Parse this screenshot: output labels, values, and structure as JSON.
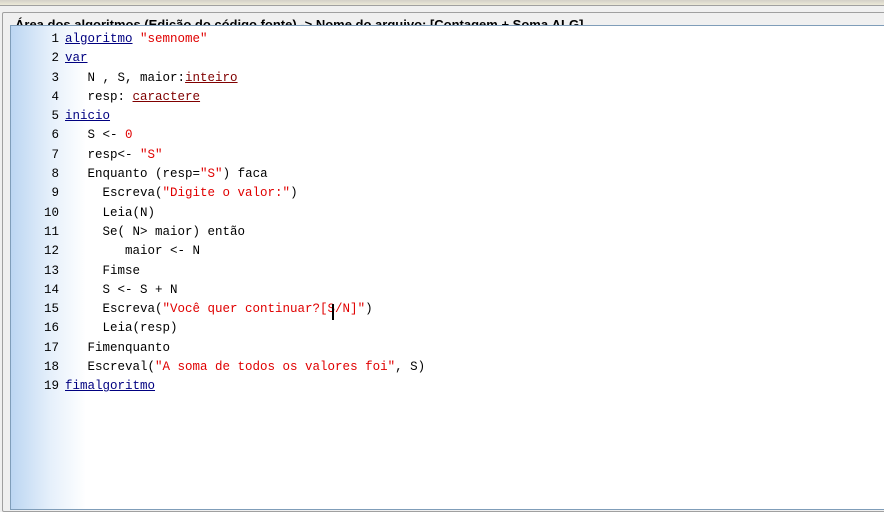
{
  "groupbox": {
    "title": "Área dos algoritmos (Edição do código fonte) -> Nome do arquivo: [Contagem + Soma.ALG]"
  },
  "code_lines": [
    {
      "n": "1",
      "indent": "",
      "tokens": [
        {
          "t": "kw",
          "v": "algoritmo"
        },
        {
          "t": "txt",
          "v": " "
        },
        {
          "t": "str",
          "v": "\"semnome\""
        }
      ]
    },
    {
      "n": "2",
      "indent": "",
      "tokens": [
        {
          "t": "kw",
          "v": "var"
        }
      ]
    },
    {
      "n": "3",
      "indent": "   ",
      "tokens": [
        {
          "t": "txt",
          "v": "N , S, maior:"
        },
        {
          "t": "type",
          "v": "inteiro"
        }
      ]
    },
    {
      "n": "4",
      "indent": "   ",
      "tokens": [
        {
          "t": "txt",
          "v": "resp: "
        },
        {
          "t": "type",
          "v": "caractere"
        }
      ]
    },
    {
      "n": "5",
      "indent": "",
      "tokens": [
        {
          "t": "kw",
          "v": "inicio"
        }
      ]
    },
    {
      "n": "6",
      "indent": "   ",
      "tokens": [
        {
          "t": "txt",
          "v": "S <- "
        },
        {
          "t": "num",
          "v": "0"
        }
      ]
    },
    {
      "n": "7",
      "indent": "   ",
      "tokens": [
        {
          "t": "txt",
          "v": "resp<- "
        },
        {
          "t": "str",
          "v": "\"S\""
        }
      ]
    },
    {
      "n": "8",
      "indent": "   ",
      "tokens": [
        {
          "t": "txt",
          "v": "Enquanto (resp="
        },
        {
          "t": "str",
          "v": "\"S\""
        },
        {
          "t": "txt",
          "v": ") faca"
        }
      ]
    },
    {
      "n": "9",
      "indent": "     ",
      "tokens": [
        {
          "t": "txt",
          "v": "Escreva("
        },
        {
          "t": "str",
          "v": "\"Digite o valor:\""
        },
        {
          "t": "txt",
          "v": ")"
        }
      ]
    },
    {
      "n": "10",
      "indent": "     ",
      "tokens": [
        {
          "t": "txt",
          "v": "Leia(N)"
        }
      ]
    },
    {
      "n": "11",
      "indent": "     ",
      "tokens": [
        {
          "t": "txt",
          "v": "Se( N> maior) então"
        }
      ]
    },
    {
      "n": "12",
      "indent": "        ",
      "tokens": [
        {
          "t": "txt",
          "v": "maior <- N"
        }
      ]
    },
    {
      "n": "13",
      "indent": "     ",
      "tokens": [
        {
          "t": "txt",
          "v": "Fimse"
        }
      ]
    },
    {
      "n": "14",
      "indent": "     ",
      "tokens": [
        {
          "t": "txt",
          "v": "S <- S + N"
        }
      ]
    },
    {
      "n": "15",
      "indent": "     ",
      "tokens": [
        {
          "t": "txt",
          "v": "Escreva("
        },
        {
          "t": "str",
          "v": "\"Você quer continuar?[S/N]\""
        },
        {
          "t": "txt",
          "v": ")"
        }
      ]
    },
    {
      "n": "16",
      "indent": "     ",
      "tokens": [
        {
          "t": "txt",
          "v": "Leia(resp)"
        }
      ]
    },
    {
      "n": "17",
      "indent": "   ",
      "tokens": [
        {
          "t": "txt",
          "v": "Fimenquanto"
        }
      ]
    },
    {
      "n": "18",
      "indent": "   ",
      "tokens": [
        {
          "t": "txt",
          "v": "Escreval("
        },
        {
          "t": "str",
          "v": "\"A soma de todos os valores foi\""
        },
        {
          "t": "txt",
          "v": ", S)"
        }
      ]
    },
    {
      "n": "19",
      "indent": "",
      "tokens": [
        {
          "t": "kw",
          "v": "fimalgoritmo"
        }
      ]
    }
  ],
  "colors": {
    "keyword": "#000080",
    "type": "#800000",
    "string": "#e00000",
    "text": "#000000"
  }
}
